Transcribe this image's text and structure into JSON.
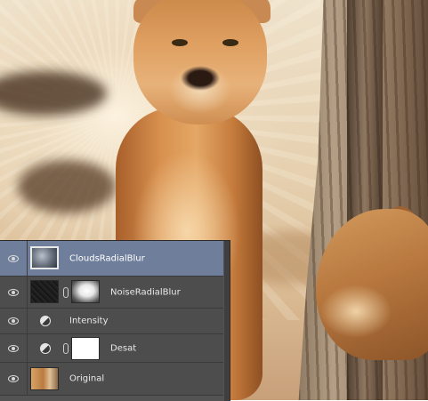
{
  "layers_panel": {
    "layers": [
      {
        "name": "CloudsRadialBlur",
        "visible": true,
        "selected": true,
        "kind": "pixel",
        "thumbnail": "clouds-thumbnail",
        "mask": null
      },
      {
        "name": "NoiseRadialBlur",
        "visible": true,
        "selected": false,
        "kind": "pixel",
        "thumbnail": "noise-thumbnail",
        "mask": "soft-mask-thumbnail"
      },
      {
        "name": "Intensity",
        "visible": true,
        "selected": false,
        "kind": "adjustment",
        "thumbnail": "adjustment-icon",
        "mask": null
      },
      {
        "name": "Desat",
        "visible": true,
        "selected": false,
        "kind": "adjustment",
        "thumbnail": "adjustment-icon",
        "mask": "white-mask-thumbnail"
      },
      {
        "name": "Original",
        "visible": true,
        "selected": false,
        "kind": "pixel",
        "thumbnail": "photo-thumbnail",
        "mask": null
      }
    ],
    "colors": {
      "panel_bg": "#535353",
      "row_bg": "#4d4d4d",
      "selected_row_bg": "#6f7f9b",
      "text": "#e9e9e9"
    }
  }
}
